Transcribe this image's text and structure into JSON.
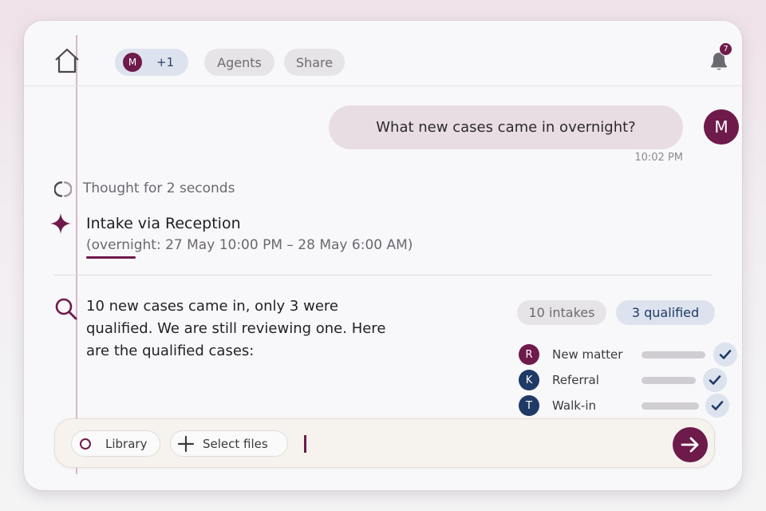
{
  "header": {
    "user_initial": "M",
    "extra_users": "+1",
    "agents_label": "Agents",
    "share_label": "Share",
    "notifications_count": "7"
  },
  "message": {
    "text": "What new cases came in overnight?",
    "time": "10:02 PM",
    "avatar_initial": "M"
  },
  "thought": {
    "label": "Thought for 2 seconds"
  },
  "intake": {
    "title": "Intake via Reception",
    "subtitle": "(overnight: 27 May 10:00 PM – 28 May 6:00 AM)"
  },
  "answer": {
    "text": "10 new cases came in, only 3 were qualified. We are still reviewing one. Here are the qualified cases:",
    "intakes_chip": "10 intakes",
    "qualified_chip": "3 qualified"
  },
  "cases": [
    {
      "initial": "R",
      "label": "New matter",
      "color": "#6e1a4b",
      "checked": true
    },
    {
      "initial": "K",
      "label": "Referral",
      "color": "#1f3a66",
      "checked": true
    },
    {
      "initial": "T",
      "label": "Walk-in",
      "color": "#1f3a66",
      "checked": true
    }
  ],
  "composer": {
    "library_label": "Library",
    "files_label": "Select files"
  },
  "colors": {
    "accent": "#6e1a4b",
    "navy": "#1f3a66"
  },
  "icons": {
    "home": "home-icon",
    "bell": "bell-icon",
    "spinner": "spinner-icon",
    "sparkle": "sparkle-icon",
    "search": "search-icon",
    "plus": "plus-icon",
    "send": "arrow-right-icon",
    "check": "check-icon"
  }
}
